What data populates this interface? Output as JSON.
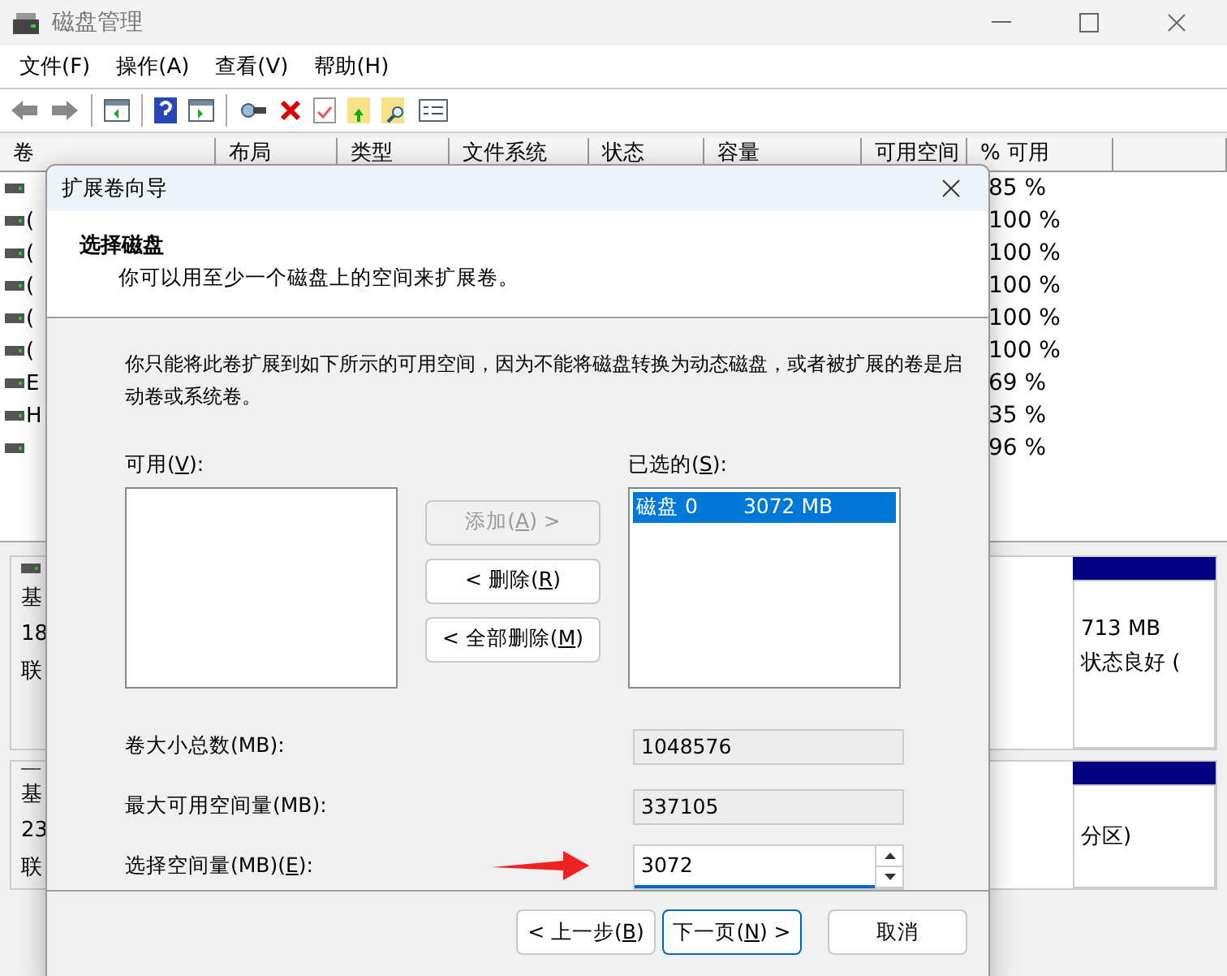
{
  "window": {
    "title": "磁盘管理"
  },
  "menu": [
    "文件(F)",
    "操作(A)",
    "查看(V)",
    "帮助(H)"
  ],
  "table": {
    "columns": [
      "卷",
      "布局",
      "类型",
      "文件系统",
      "状态",
      "容量",
      "可用空间",
      "% 可用"
    ],
    "rows": [
      {
        "volume": "",
        "percent_free": "85 %"
      },
      {
        "volume": "(",
        "percent_free": "100 %"
      },
      {
        "volume": "(",
        "percent_free": "100 %"
      },
      {
        "volume": "(",
        "percent_free": "100 %"
      },
      {
        "volume": "(",
        "percent_free": "100 %"
      },
      {
        "volume": "(",
        "percent_free": "100 %"
      },
      {
        "volume": "E",
        "percent_free": "69 %"
      },
      {
        "volume": "H",
        "percent_free": "35 %"
      },
      {
        "volume": "",
        "percent_free": "96 %"
      }
    ]
  },
  "disks": [
    {
      "lines": [
        "基",
        "18",
        "联"
      ],
      "partition": {
        "lines": [
          "713 MB",
          "状态良好 ("
        ]
      }
    },
    {
      "lines": [
        "基",
        "23",
        "联"
      ],
      "partition": {
        "lines": [
          "分区)"
        ]
      }
    }
  ],
  "dialog": {
    "title": "扩展卷向导",
    "heading": "选择磁盘",
    "subheading": "你可以用至少一个磁盘上的空间来扩展卷。",
    "description": "你只能将此卷扩展到如下所示的可用空间，因为不能将磁盘转换为动态磁盘，或者被扩展的卷是启动卷或系统卷。",
    "available": {
      "label": {
        "before": "可用(",
        "key": "V",
        "after": "):"
      }
    },
    "selected": {
      "label": {
        "before": "已选的(",
        "key": "S",
        "after": "):"
      },
      "items": [
        {
          "disk": "磁盘 0",
          "size": "3072 MB",
          "selected": true
        }
      ]
    },
    "buttons": [
      {
        "label": {
          "before": "添加(",
          "key": "A",
          "after": ") >"
        },
        "disabled": true
      },
      {
        "label": {
          "before": "< 删除(",
          "key": "R",
          "after": ")"
        },
        "disabled": false
      },
      {
        "label": {
          "before": "< 全部删除(",
          "key": "M",
          "after": ")"
        },
        "disabled": false
      }
    ],
    "fields": [
      {
        "label": {
          "before": "卷大小总数(MB):"
        },
        "value": "1048576",
        "kind": "readonly"
      },
      {
        "label": {
          "before": "最大可用空间量(MB):"
        },
        "value": "337105",
        "kind": "readonly"
      },
      {
        "label": {
          "before": "选择空间量(MB)(",
          "key": "E",
          "after": "):"
        },
        "value": "3072",
        "kind": "spinner"
      }
    ],
    "footer": [
      {
        "label": {
          "before": "< 上一步(",
          "key": "B",
          "after": ")"
        },
        "default": false
      },
      {
        "label": {
          "before": "下一页(",
          "key": "N",
          "after": ") >"
        },
        "default": true
      },
      {
        "label": {
          "before": "取消"
        },
        "default": false
      }
    ]
  }
}
